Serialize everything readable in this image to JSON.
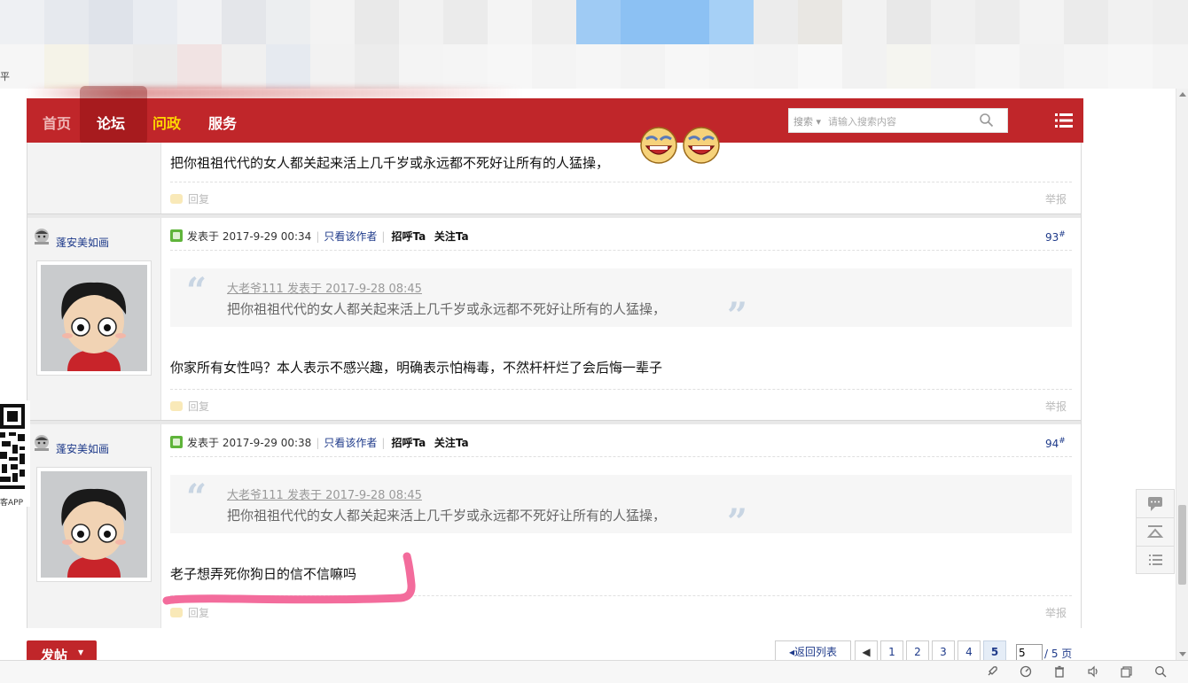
{
  "browser": {
    "partial_char": "平"
  },
  "nav": {
    "items": [
      "首页",
      "论坛",
      "问政",
      "服务"
    ],
    "search_type": "搜索",
    "search_placeholder": "请输入搜索内容"
  },
  "posts": [
    {
      "body": "把你祖祖代代的女人都关起来活上几千岁或永远都不死好让所有的人猛操，",
      "reply_label": "回复",
      "report_label": "举报"
    },
    {
      "author": "蓬安美如画",
      "posted": "发表于 2017-9-29 00:34",
      "only_author": "只看该作者",
      "greet": "招呼Ta",
      "follow": "关注Ta",
      "floor": "93",
      "floor_mark": "#",
      "quote_head": "大老爷111 发表于 2017-9-28 08:45",
      "quote_text": "把你祖祖代代的女人都关起来活上几千岁或永远都不死好让所有的人猛操，",
      "body": "你家所有女性吗？本人表示不感兴趣，明确表示怕梅毒，不然杆杆烂了会后悔一辈子",
      "reply_label": "回复",
      "report_label": "举报"
    },
    {
      "author": "蓬安美如画",
      "posted": "发表于 2017-9-29 00:38",
      "only_author": "只看该作者",
      "greet": "招呼Ta",
      "follow": "关注Ta",
      "floor": "94",
      "floor_mark": "#",
      "quote_head": "大老爷111 发表于 2017-9-28 08:45",
      "quote_text": "把你祖祖代代的女人都关起来活上几千岁或永远都不死好让所有的人猛操，",
      "body": "老子想弄死你狗日的信不信嘛吗",
      "reply_label": "回复",
      "report_label": "举报"
    }
  ],
  "left_strip": {
    "label": "客APP"
  },
  "footer": {
    "post_button": "发帖",
    "back_to_list": "返回列表",
    "pages": [
      "1",
      "2",
      "3",
      "4",
      "5"
    ],
    "current_page": "5",
    "total": "/ 5 页"
  },
  "colors": {
    "brand_red": "#c0262a",
    "link_blue": "#1e3a8a",
    "nav_active_yellow": "#ffd800"
  }
}
